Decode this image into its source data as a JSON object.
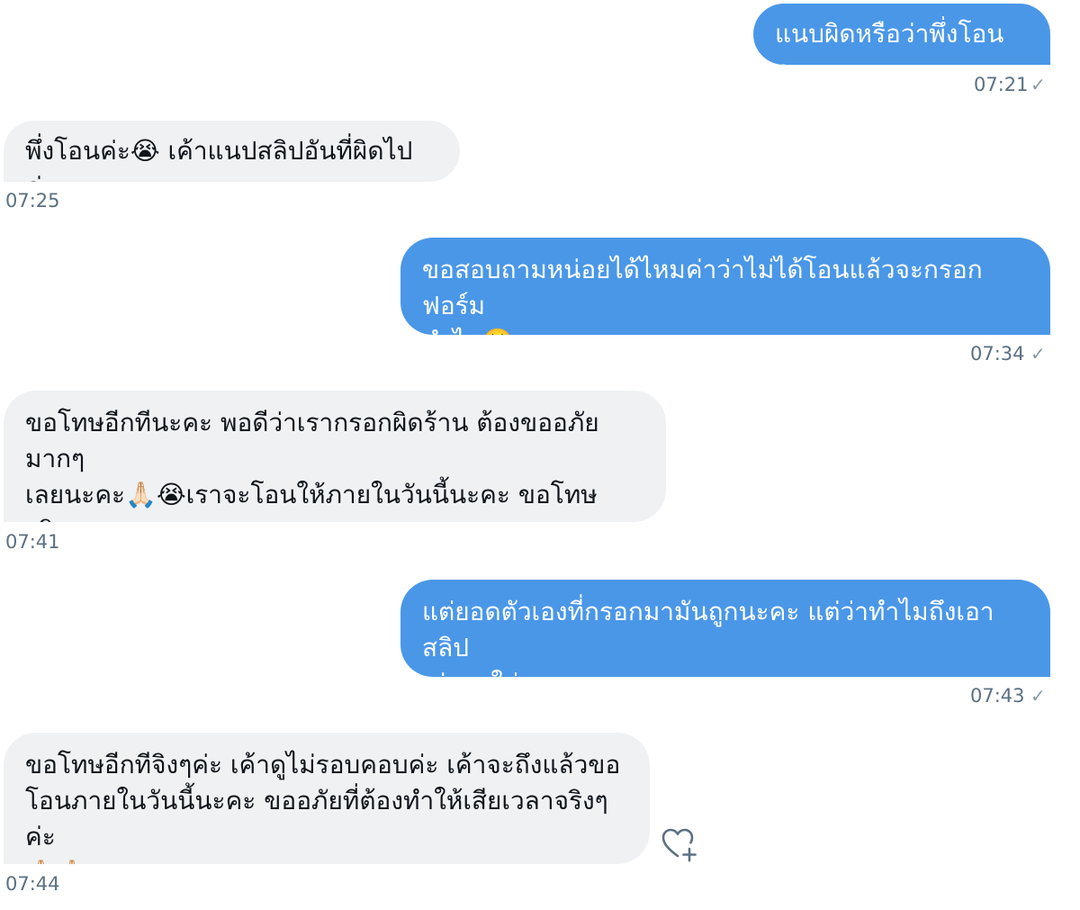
{
  "messages": [
    {
      "side": "sent",
      "text": "แนบผิดหรือว่าพึ่งโอนคะ",
      "time": "07:21",
      "status_icon": "check-icon"
    },
    {
      "side": "received",
      "text": "พึ่งโอนค่ะ😭 เค้าแนปสลิปอันที่ผิดไปค่ะ",
      "time": "07:25"
    },
    {
      "side": "sent",
      "text": "ขอสอบถามหน่อยได้ไหมค่าว่าไม่ได้โอนแล้วจะกรอกฟอร์ม\nทำไม🥺",
      "time": "07:34",
      "status_icon": "check-icon"
    },
    {
      "side": "received",
      "text": "ขอโทษอีกทีนะคะ พอดีว่าเรากรอกผิดร้าน ต้องขออภัยมากๆ\nเลยนะคะ🙏🏻😭เราจะโอนให้ภายในวันนี้นะคะ ขอโทษจริงๆ\nค่ะ",
      "time": "07:41"
    },
    {
      "side": "sent",
      "text": "แต่ยอดตัวเองที่กรอกมามันถูกนะคะ แต่ว่าทำไมถึงเอาสลิป\nเก่ามาใส่คะ",
      "time": "07:43",
      "status_icon": "check-icon"
    },
    {
      "side": "received",
      "text": "ขอโทษอีกทีจิงๆค่ะ เค้าดูไม่รอบคอบค่ะ เค้าจะถึงแล้วขอ\nโอนภายในวันนี้นะคะ ขออภัยที่ต้องทำให้เสียเวลาจริงๆค่ะ\n🙏🏻🙏🏻",
      "time": "07:44",
      "action_icon": "heart-plus-icon"
    }
  ],
  "colors": {
    "sent_bubble": "#4a97e8",
    "received_bubble": "#eff1f3",
    "timestamp": "#5b7083"
  }
}
